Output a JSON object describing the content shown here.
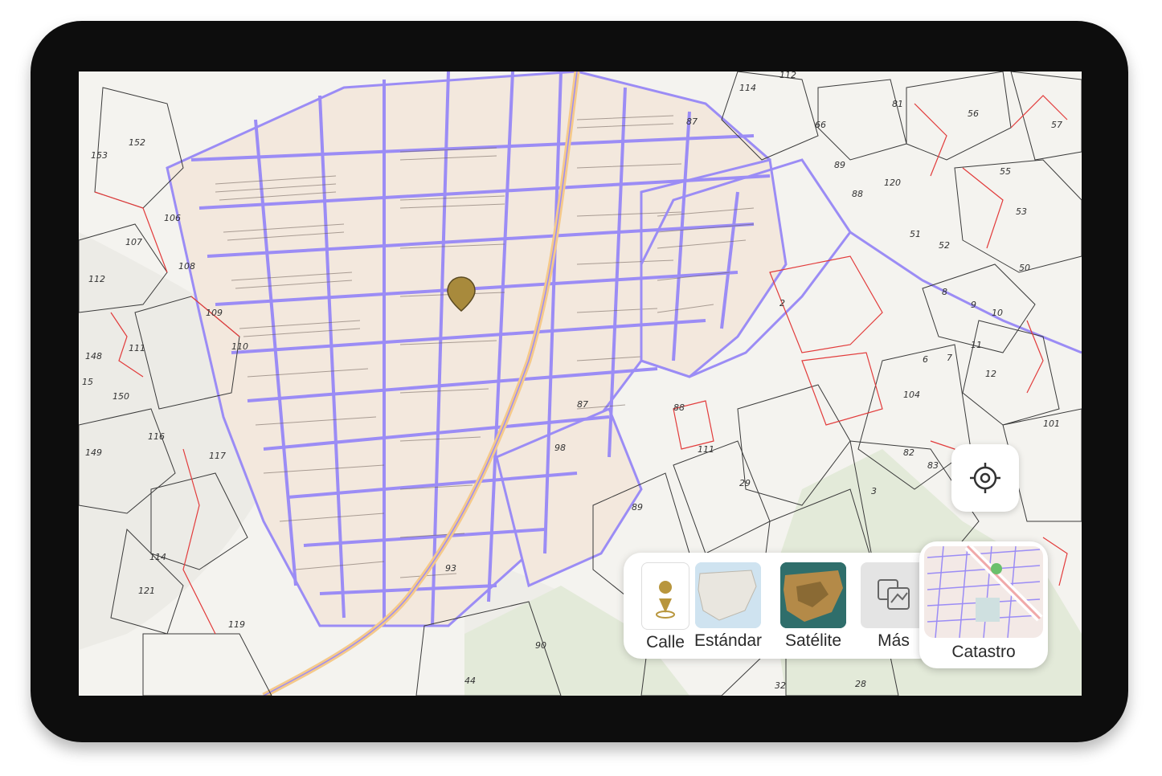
{
  "map": {
    "parcel_labels": [
      {
        "text": "152"
      },
      {
        "text": "153"
      },
      {
        "text": "107"
      },
      {
        "text": "106"
      },
      {
        "text": "108"
      },
      {
        "text": "112"
      },
      {
        "text": "109"
      },
      {
        "text": "111"
      },
      {
        "text": "148"
      },
      {
        "text": "15"
      },
      {
        "text": "150"
      },
      {
        "text": "110"
      },
      {
        "text": "116"
      },
      {
        "text": "149"
      },
      {
        "text": "117"
      },
      {
        "text": "114"
      },
      {
        "text": "121"
      },
      {
        "text": "119"
      },
      {
        "text": "114"
      },
      {
        "text": "112"
      },
      {
        "text": "87"
      },
      {
        "text": "66"
      },
      {
        "text": "89"
      },
      {
        "text": "88"
      },
      {
        "text": "120"
      },
      {
        "text": "81"
      },
      {
        "text": "56"
      },
      {
        "text": "57"
      },
      {
        "text": "55"
      },
      {
        "text": "53"
      },
      {
        "text": "51"
      },
      {
        "text": "52"
      },
      {
        "text": "50"
      },
      {
        "text": "8"
      },
      {
        "text": "9"
      },
      {
        "text": "10"
      },
      {
        "text": "2"
      },
      {
        "text": "6"
      },
      {
        "text": "7"
      },
      {
        "text": "11"
      },
      {
        "text": "12"
      },
      {
        "text": "104"
      },
      {
        "text": "101"
      },
      {
        "text": "87"
      },
      {
        "text": "88"
      },
      {
        "text": "98"
      },
      {
        "text": "111"
      },
      {
        "text": "29"
      },
      {
        "text": "89"
      },
      {
        "text": "3"
      },
      {
        "text": "82"
      },
      {
        "text": "83"
      },
      {
        "text": "93"
      },
      {
        "text": "90"
      },
      {
        "text": "44"
      },
      {
        "text": "32"
      },
      {
        "text": "28"
      }
    ]
  },
  "controls": {
    "locate_icon": "crosshair-icon"
  },
  "layers": {
    "items": [
      {
        "label": "Calle",
        "icon": "street-pin-icon"
      },
      {
        "label": "Estándar",
        "icon": "standard-map-thumbnail"
      },
      {
        "label": "Satélite",
        "icon": "satellite-map-thumbnail"
      },
      {
        "label": "Más",
        "icon": "more-layers-icon"
      }
    ],
    "active": {
      "label": "Catastro",
      "icon": "cadastre-map-thumbnail"
    }
  },
  "colors": {
    "street_outline": "#9b8cf5",
    "parcel_red": "#e23b3b",
    "road": "#f5c98a",
    "pin": "#a88a3c",
    "vegetation": "#dfe8d5"
  }
}
